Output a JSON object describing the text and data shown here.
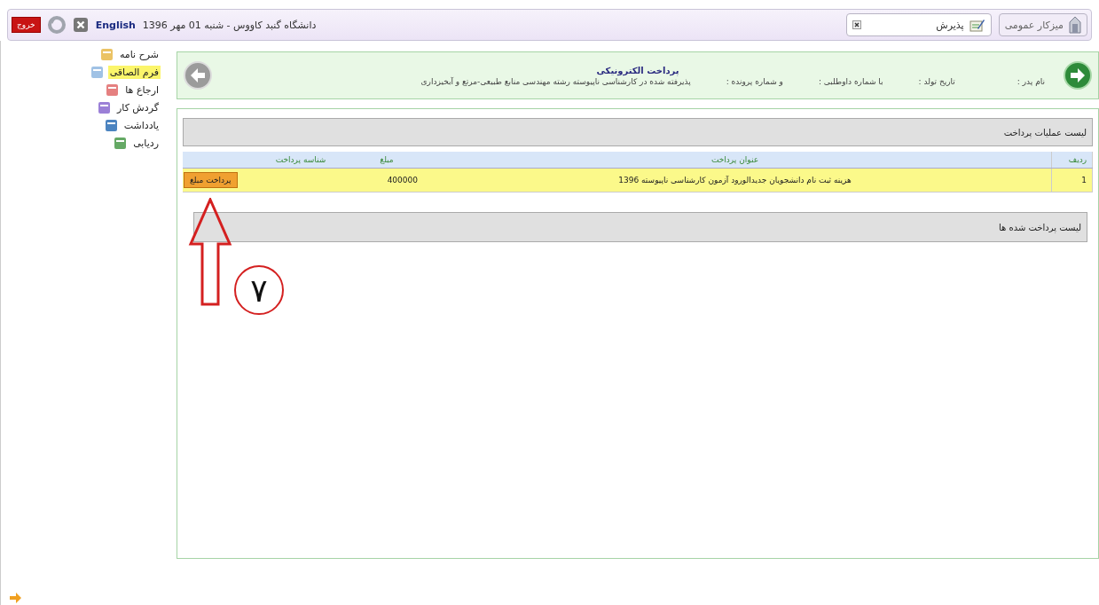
{
  "top_bar": {
    "exit_button": "خروج",
    "language": "English",
    "date_line": "دانشگاه گنبد کاووس - شنبه 01 مهر 1396"
  },
  "tabs": [
    {
      "label": "میزکار عمومی",
      "selected": false,
      "closable": false
    },
    {
      "label": "پذیرش",
      "selected": true,
      "closable": true
    }
  ],
  "sidebar": {
    "items": [
      {
        "label": "شرح نامه",
        "selected": false
      },
      {
        "label": "فرم الصاقی",
        "selected": true
      },
      {
        "label": "ارجاع ها",
        "selected": false
      },
      {
        "label": "گردش کار",
        "selected": false
      },
      {
        "label": "یادداشت",
        "selected": false
      },
      {
        "label": "ردیابی",
        "selected": false
      }
    ]
  },
  "header": {
    "title": "پرداخت الکترونیکی",
    "fields": [
      "نام پدر :",
      "تاریخ تولد :",
      "با شماره داوطلبی :",
      "و شماره پرونده :",
      "پذیرفته شده در کارشناسی ناپیوسته رشته مهندسی منابع طبیعی-مرتع و آبخیزداری"
    ]
  },
  "payments": {
    "title": "لیست عملیات پرداخت",
    "columns": [
      "ردیف",
      "عنوان پرداخت",
      "مبلغ",
      "شناسه پرداخت"
    ],
    "rows": [
      {
        "number": "1",
        "title": "هزینه ثبت نام دانشجویان جدیدالورود آزمون کارشناسی ناپیوسته 1396",
        "amount": "400000",
        "button": "پرداخت مبلغ"
      }
    ]
  },
  "paid": {
    "title": "لیست پرداخت شده ها"
  },
  "annotation": {
    "label": "۷"
  }
}
